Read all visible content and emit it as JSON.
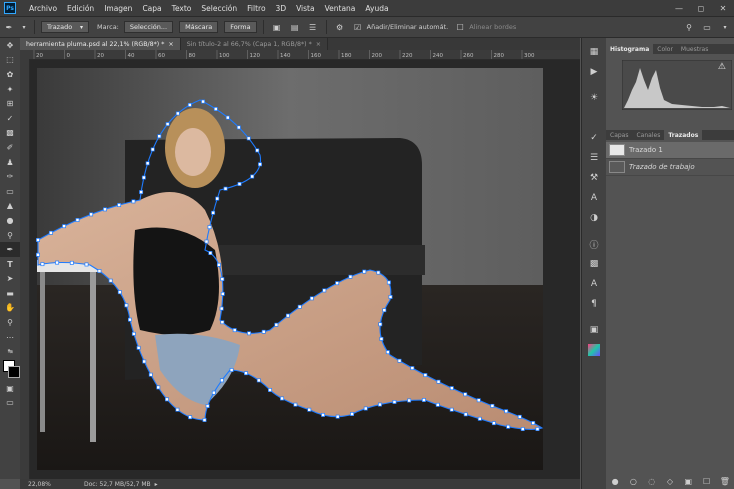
{
  "menu": {
    "items": [
      "Archivo",
      "Edición",
      "Imagen",
      "Capa",
      "Texto",
      "Selección",
      "Filtro",
      "3D",
      "Vista",
      "Ventana",
      "Ayuda"
    ],
    "logo": "Ps"
  },
  "options": {
    "mode": "Trazado",
    "marca_label": "Marca:",
    "seleccion": "Selección...",
    "mascara": "Máscara",
    "forma": "Forma",
    "auto_add": "Añadir/Eliminar automát.",
    "align_edges": "Alinear bordes"
  },
  "tabs": [
    {
      "label": "herramienta pluma.psd al 22,1% (RGB/8*) *"
    },
    {
      "label": "Sin título-2 al 66,7% (Capa 1, RGB/8*) *"
    }
  ],
  "ruler_ticks": [
    "20",
    "0",
    "20",
    "40",
    "60",
    "80",
    "100",
    "120",
    "140",
    "160",
    "180",
    "200",
    "220",
    "240",
    "260",
    "280",
    "300"
  ],
  "status": {
    "zoom": "22,08%",
    "doc": "Doc: 52,7 MB/52,7 MB"
  },
  "panels": {
    "top_tabs": [
      "Histograma",
      "Color",
      "Muestras"
    ],
    "mid_tabs": [
      "Capas",
      "Canales",
      "Trazados"
    ],
    "paths": [
      {
        "name": "Trazado 1"
      },
      {
        "name": "Trazado de trabajo"
      }
    ]
  },
  "colors": {
    "accent": "#31a8ff",
    "path": "#1e7bff"
  }
}
